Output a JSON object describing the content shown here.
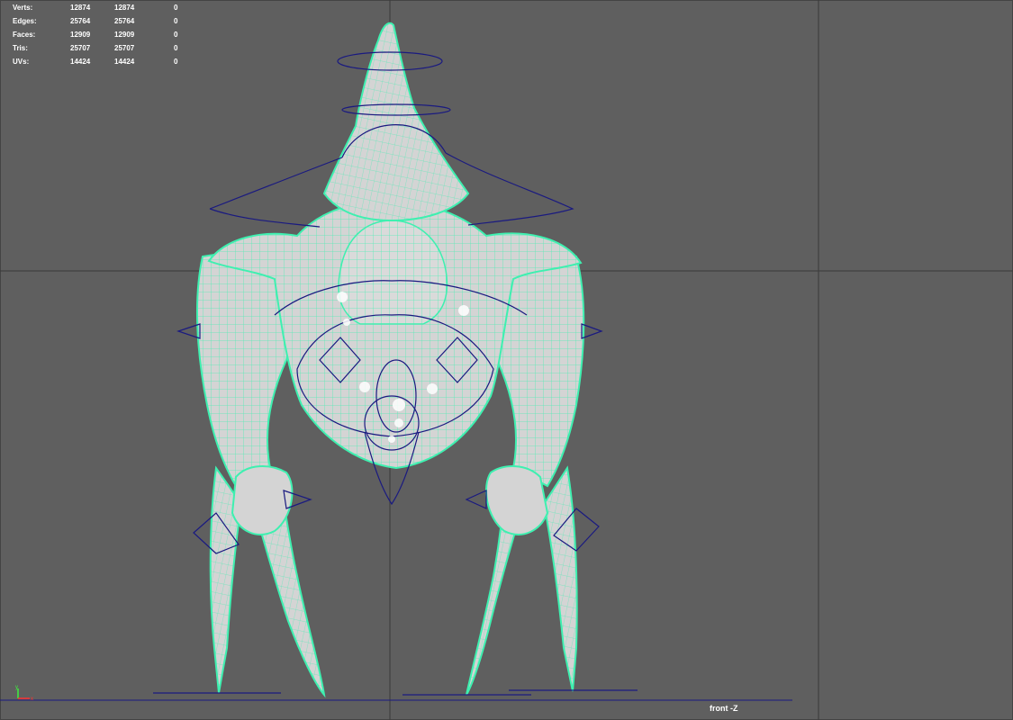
{
  "viewport": {
    "camera": "front -Z"
  },
  "heads_up_display": {
    "rows": [
      {
        "label": "Verts:",
        "col1": "12874",
        "col2": "12874",
        "col3": "0"
      },
      {
        "label": "Edges:",
        "col1": "25764",
        "col2": "25764",
        "col3": "0"
      },
      {
        "label": "Faces:",
        "col1": "12909",
        "col2": "12909",
        "col3": "0"
      },
      {
        "label": "Tris:",
        "col1": "25707",
        "col2": "25707",
        "col3": "0"
      },
      {
        "label": "UVs:",
        "col1": "14424",
        "col2": "14424",
        "col3": "0"
      }
    ]
  },
  "axis_gizmo": {
    "x": "x",
    "y": "y"
  },
  "colors": {
    "background": "#5f5f5f",
    "grid_line": "#3c3c3c",
    "mesh_fill": "#d4d4d4",
    "wireframe": "#3ef0b0",
    "nurbs_controls": "#1a1a80",
    "hud_text": "#ffffff"
  }
}
